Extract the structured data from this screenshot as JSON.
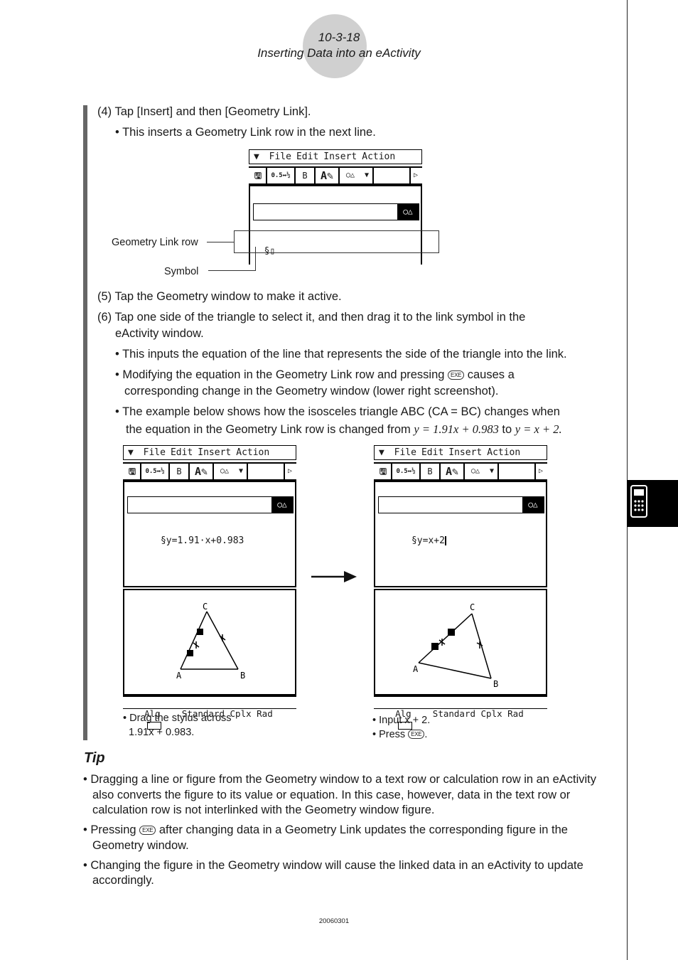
{
  "header": {
    "page_number": "10-3-18",
    "section_title": "Inserting Data into an eActivity"
  },
  "steps": {
    "step4": {
      "label": "(4) Tap [Insert] and then [Geometry Link].",
      "bullet": "• This inserts a Geometry Link row in the next line."
    },
    "step5": {
      "label": "(5) Tap the Geometry window to make it active."
    },
    "step6": {
      "label_line1": "(6) Tap one side of the triangle to select it, and then drag it to the link symbol in the",
      "label_line2": "eActivity window.",
      "bullet1": "• This inputs the equation of the line that represents the side of the triangle into the link.",
      "bullet2_a": "• Modifying the equation in the Geometry Link row and pressing",
      "bullet2_b": "causes a",
      "bullet2_line2": "corresponding change in the Geometry window (lower right screenshot).",
      "bullet3_line1": "• The example below shows how the isosceles triangle ABC (CA = BC) changes when",
      "bullet3_line2_a": "the equation in the Geometry Link row is changed from",
      "eq_from": "y = 1.91x + 0.983",
      "bullet3_to": "to",
      "eq_to": "y = x + 2."
    }
  },
  "exe_key": "EXE",
  "calc": {
    "menu": {
      "icon": "menu-chevron-icon",
      "items": [
        "File",
        "Edit",
        "Insert",
        "Action"
      ]
    },
    "toolbar": [
      "save-icon",
      "fraction-decimal-icon",
      "B",
      "text-style-icon",
      "geometry-link-icon",
      "dropdown-arrow-icon",
      "",
      "scroll-right-icon"
    ],
    "toolbar_bold": "B",
    "geometry_button_icon": "geometry-icon",
    "link_symbol": "§"
  },
  "figure1": {
    "callout_row": "Geometry Link row",
    "callout_symbol": "Symbol",
    "cursor": "▯"
  },
  "screen_left": {
    "link_value": "y=1.91·x+0.983",
    "status": "Alg    Standard Cplx Rad",
    "vertex_labels": [
      "A",
      "B",
      "C"
    ],
    "caption_line1": "• Drag the stylus across",
    "caption_line2": "1.91x + 0.983."
  },
  "screen_right": {
    "link_value": "y=x+2",
    "status": "Alg    Standard Cplx Rad",
    "vertex_labels": [
      "A",
      "B",
      "C"
    ],
    "caption_line1": "• Input x + 2.",
    "caption_line2_a": "• Press",
    "caption_line2_b": "."
  },
  "tip": {
    "title": "Tip",
    "items": [
      [
        "• Dragging a line or figure from the Geometry window to a text row or calculation row in an eActivity",
        "also converts the figure to its value or equation. In this case, however, data in the text row or",
        "calculation row is not interlinked with the Geometry window figure."
      ],
      [
        "Geometry window."
      ],
      [
        "• Changing the figure in the Geometry window will cause the linked data in an eActivity to update",
        "accordingly."
      ]
    ],
    "item2_a": "• Pressing",
    "item2_b": "after changing data in a Geometry Link updates the corresponding figure in the"
  },
  "footer": {
    "code": "20060301"
  },
  "side_tab": {
    "icon": "calculator-icon"
  }
}
